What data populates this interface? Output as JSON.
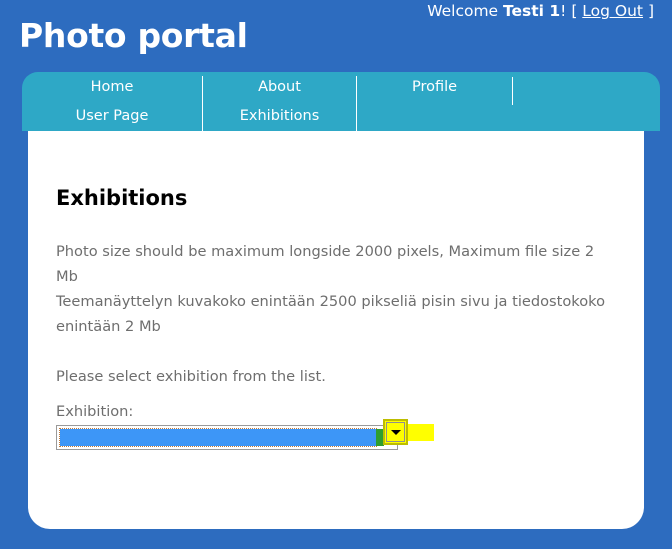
{
  "header": {
    "site_title": "Photo portal",
    "welcome_prefix": "Welcome ",
    "user_name": "Testi 1",
    "welcome_suffix": "! [ ",
    "logout_label": "Log Out",
    "bracket_close": " ]"
  },
  "nav": {
    "columns": [
      {
        "row1": "Home",
        "row2": "User Page"
      },
      {
        "row1": "About",
        "row2": "Exhibitions"
      },
      {
        "row1": "Profile",
        "row2": ""
      }
    ]
  },
  "main": {
    "heading": "Exhibitions",
    "paragraphs": [
      "Photo size should be  maximum longside 2000 pixels, Maximum file size 2 Mb",
      "Teemanäyttelyn kuvakoko enintään 2500 pikseliä pisin sivu ja tiedostokoko enintään 2 Mb",
      "Please select exhibition from the list."
    ],
    "form": {
      "exhibition_label": "Exhibition:",
      "selected_value": "",
      "dropdown_icon": "caret-down-icon"
    }
  },
  "colors": {
    "header_blue": "#2d6cbf",
    "nav_teal": "#2ea8c6",
    "content_white": "#ffffff",
    "body_text": "#6e6e6e",
    "highlight_yellow": "#ffff00",
    "selection_blue": "#3d96f7"
  }
}
